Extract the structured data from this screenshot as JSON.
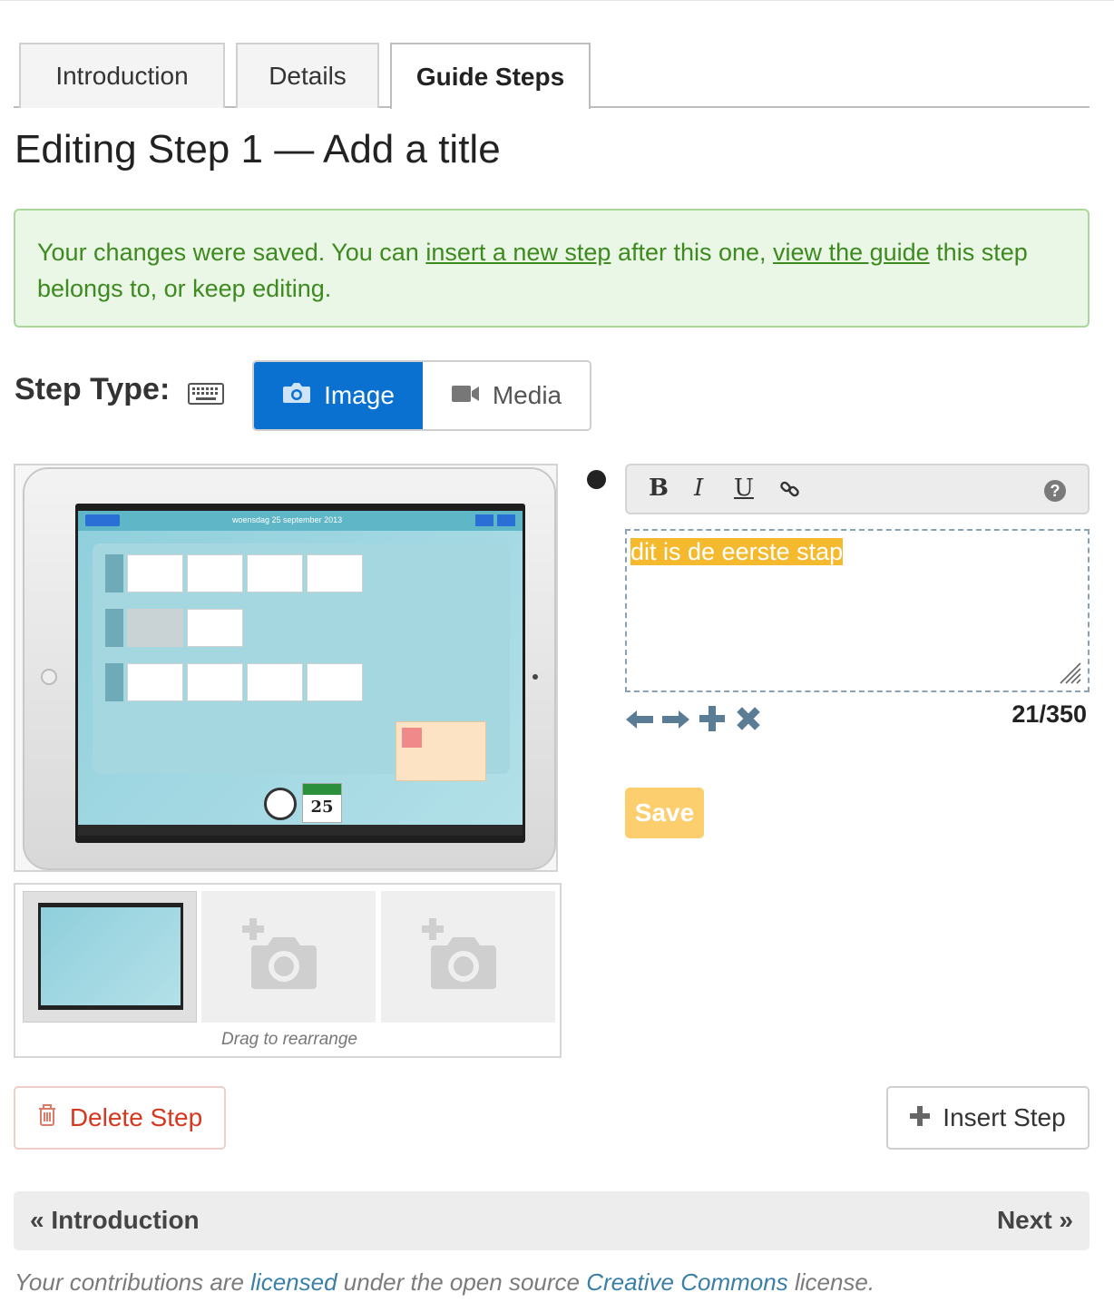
{
  "tabs": [
    {
      "label": "Introduction",
      "active": false
    },
    {
      "label": "Details",
      "active": false
    },
    {
      "label": "Guide Steps",
      "active": true
    }
  ],
  "page_title": "Editing Step 1 — Add a title",
  "alert": {
    "text_1": "Your changes were saved. You can ",
    "link_insert": "insert a new step",
    "text_2": " after this one, ",
    "link_view": "view the guide",
    "text_3": " this step belongs to, or keep editing."
  },
  "step_type": {
    "label": "Step Type:",
    "options": [
      {
        "label": "Image",
        "icon": "camera-icon",
        "selected": true
      },
      {
        "label": "Media",
        "icon": "video-camera-icon",
        "selected": false
      }
    ]
  },
  "media": {
    "screen_date": "woensdag 25 september 2013",
    "calendar_day": "25",
    "drag_hint": "Drag to rearrange"
  },
  "editor": {
    "toolbar": {
      "bold": "B",
      "italic": "I",
      "underline": "U",
      "help": "?"
    },
    "text": "dit is de eerste stap",
    "char_count": "21/350",
    "save_label": "Save"
  },
  "actions": {
    "delete_label": "Delete Step",
    "insert_label": "Insert Step"
  },
  "nav": {
    "prev_label": "« Introduction",
    "next_label": "Next »"
  },
  "footer": {
    "text_1": "Your contributions are ",
    "link_licensed": "licensed",
    "text_2": " under the open source ",
    "link_cc": "Creative Commons",
    "text_3": " license."
  },
  "colors": {
    "primary": "#0a71d0",
    "success_text": "#3d8a1f",
    "save": "#fdce6e",
    "danger": "#d5381f"
  }
}
